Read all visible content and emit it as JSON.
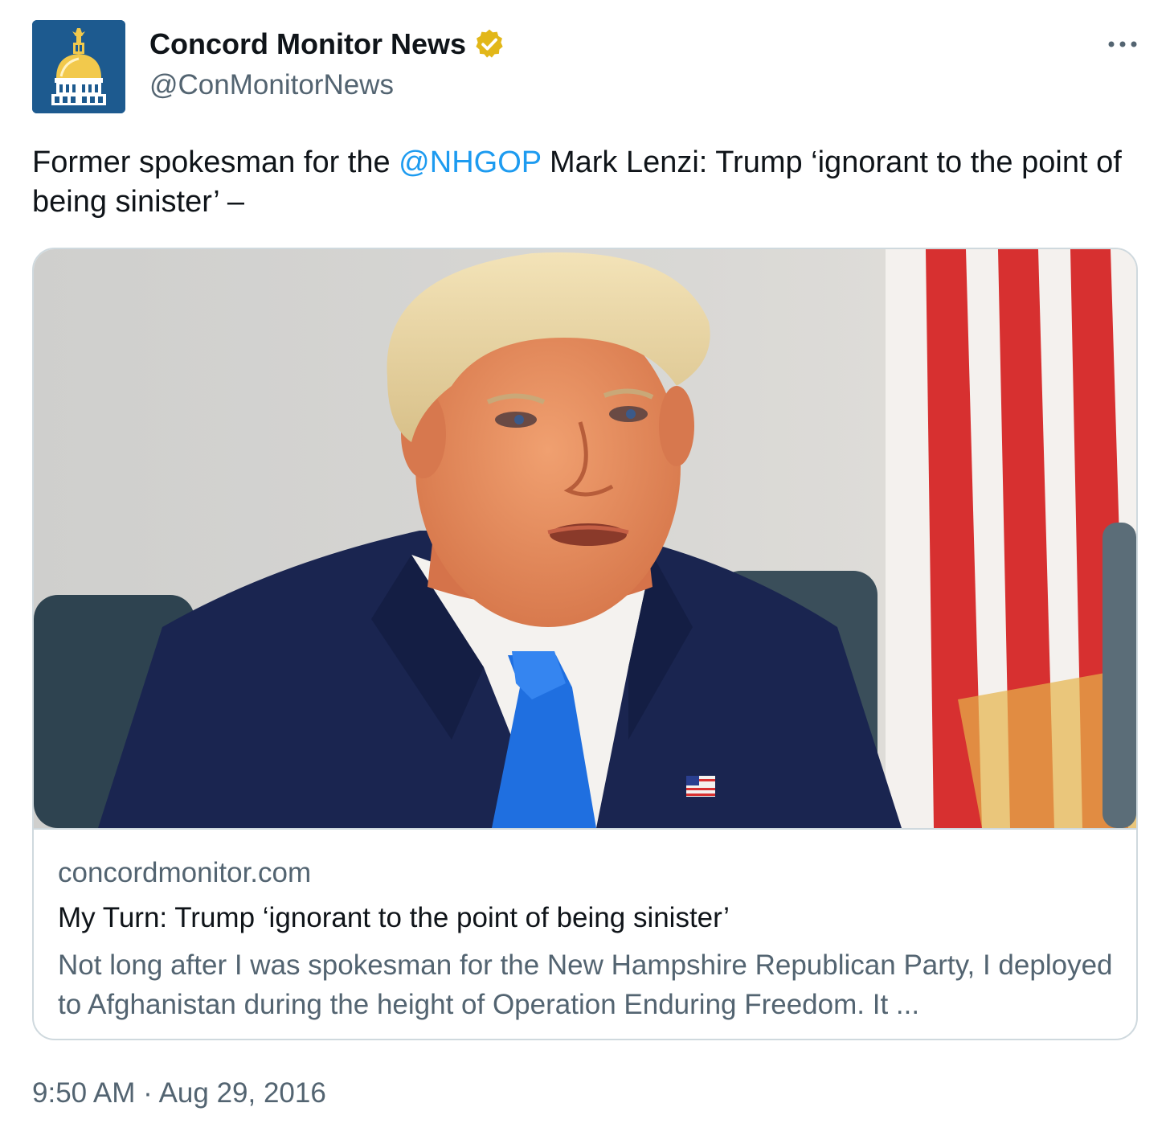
{
  "account": {
    "display_name": "Concord Monitor News",
    "handle": "@ConMonitorNews",
    "verified_icon": "verified-badge-gold",
    "avatar_icon": "state-house-dome-logo"
  },
  "more_icon": "more-options-icon",
  "tweet": {
    "text_before": "Former spokesman for the ",
    "mention": "@NHGOP",
    "text_after": " Mark Lenzi: Trump ‘ignorant to the point of being sinister’ –"
  },
  "card": {
    "image_description_icon": "article-photo",
    "domain": "concordmonitor.com",
    "title": "My Turn: Trump ‘ignorant to the point of being sinister’",
    "description": "Not long after I was spokesman for the New Hampshire Republican Party, I deployed to Afghanistan during the height of Operation Enduring Freedom. It ..."
  },
  "timestamp": "9:50 AM · Aug 29, 2016",
  "colors": {
    "link": "#1d9bf0",
    "secondary_text": "#536471",
    "border": "#cfd9de",
    "verified": "#e2b719",
    "avatar_bg": "#1d5a8f"
  }
}
